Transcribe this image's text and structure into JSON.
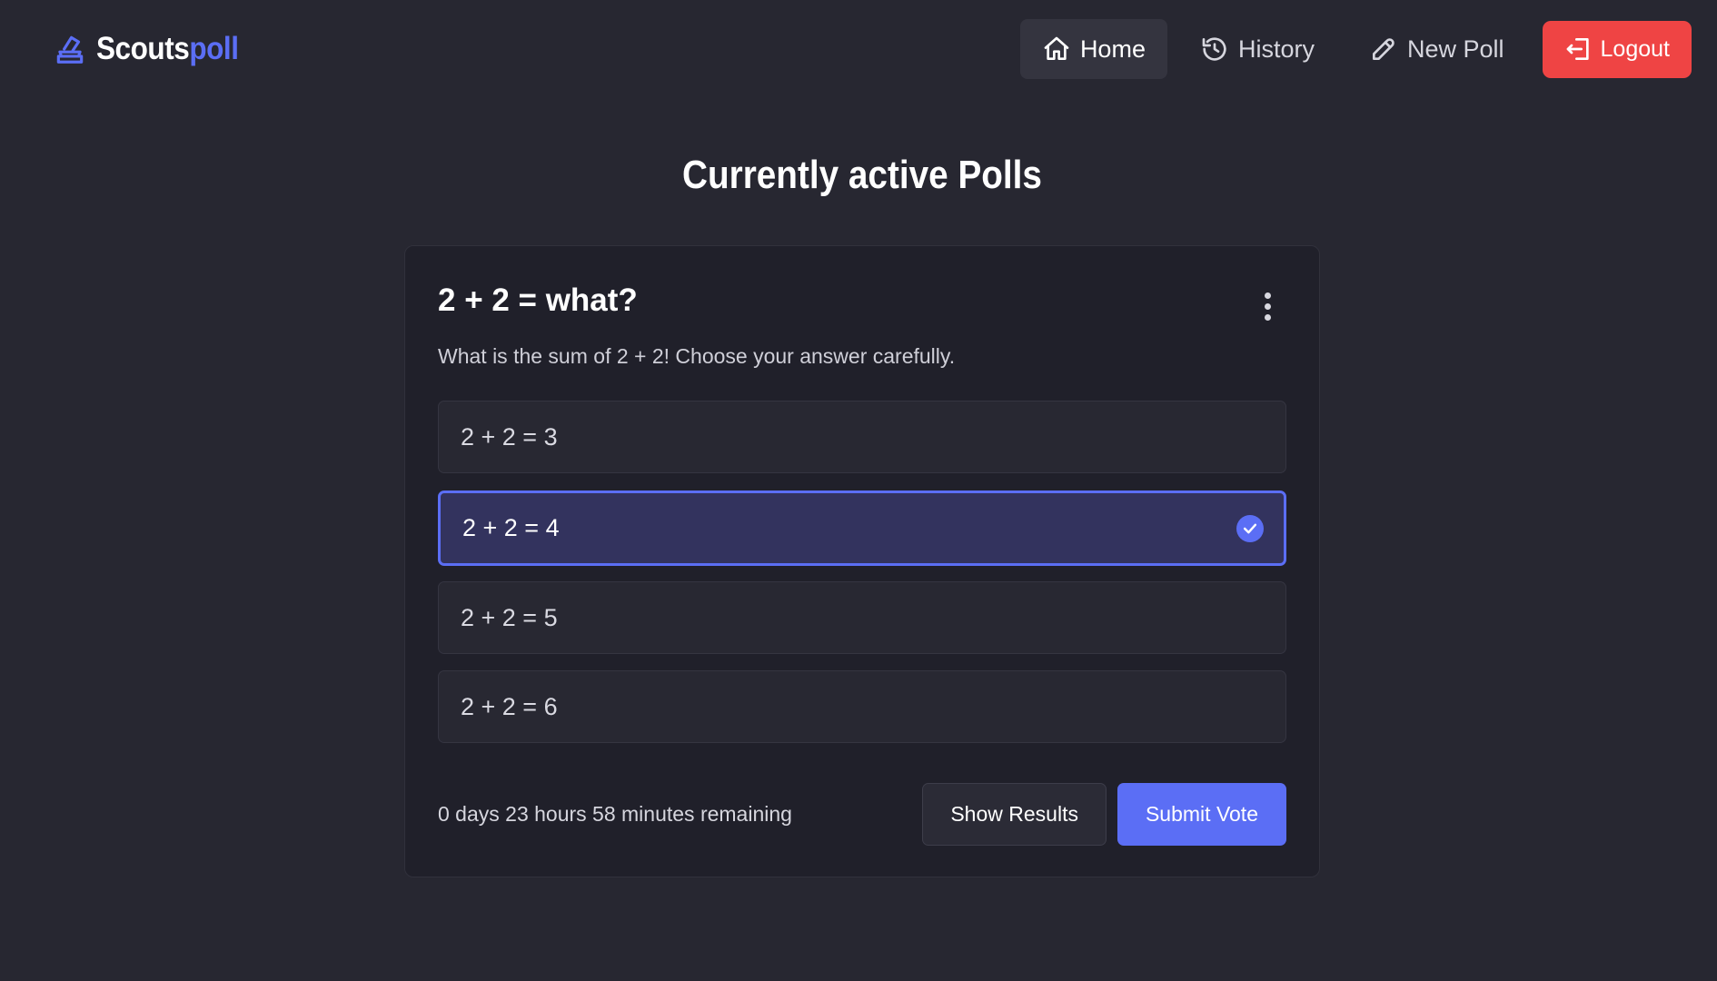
{
  "brand": {
    "name_part1": "Scouts",
    "name_part2": "poll",
    "icon": "ballot-box-icon"
  },
  "nav": {
    "items": [
      {
        "label": "Home",
        "icon": "home-icon",
        "active": true
      },
      {
        "label": "History",
        "icon": "history-icon",
        "active": false
      },
      {
        "label": "New Poll",
        "icon": "pencil-icon",
        "active": false
      }
    ],
    "logout_label": "Logout",
    "logout_icon": "logout-icon"
  },
  "page": {
    "title": "Currently active Polls"
  },
  "poll": {
    "title": "2 + 2 = what?",
    "description": "What is the sum of 2 + 2! Choose your answer carefully.",
    "options": [
      {
        "label": "2 + 2 = 3",
        "selected": false
      },
      {
        "label": "2 + 2 = 4",
        "selected": true
      },
      {
        "label": "2 + 2 = 5",
        "selected": false
      },
      {
        "label": "2 + 2 = 6",
        "selected": false
      }
    ],
    "remaining": "0 days 23 hours 58 minutes remaining",
    "show_results_label": "Show Results",
    "submit_label": "Submit Vote"
  },
  "colors": {
    "background": "#272731",
    "card": "#20202a",
    "accent": "#5b6ef5",
    "danger": "#ef4444"
  }
}
